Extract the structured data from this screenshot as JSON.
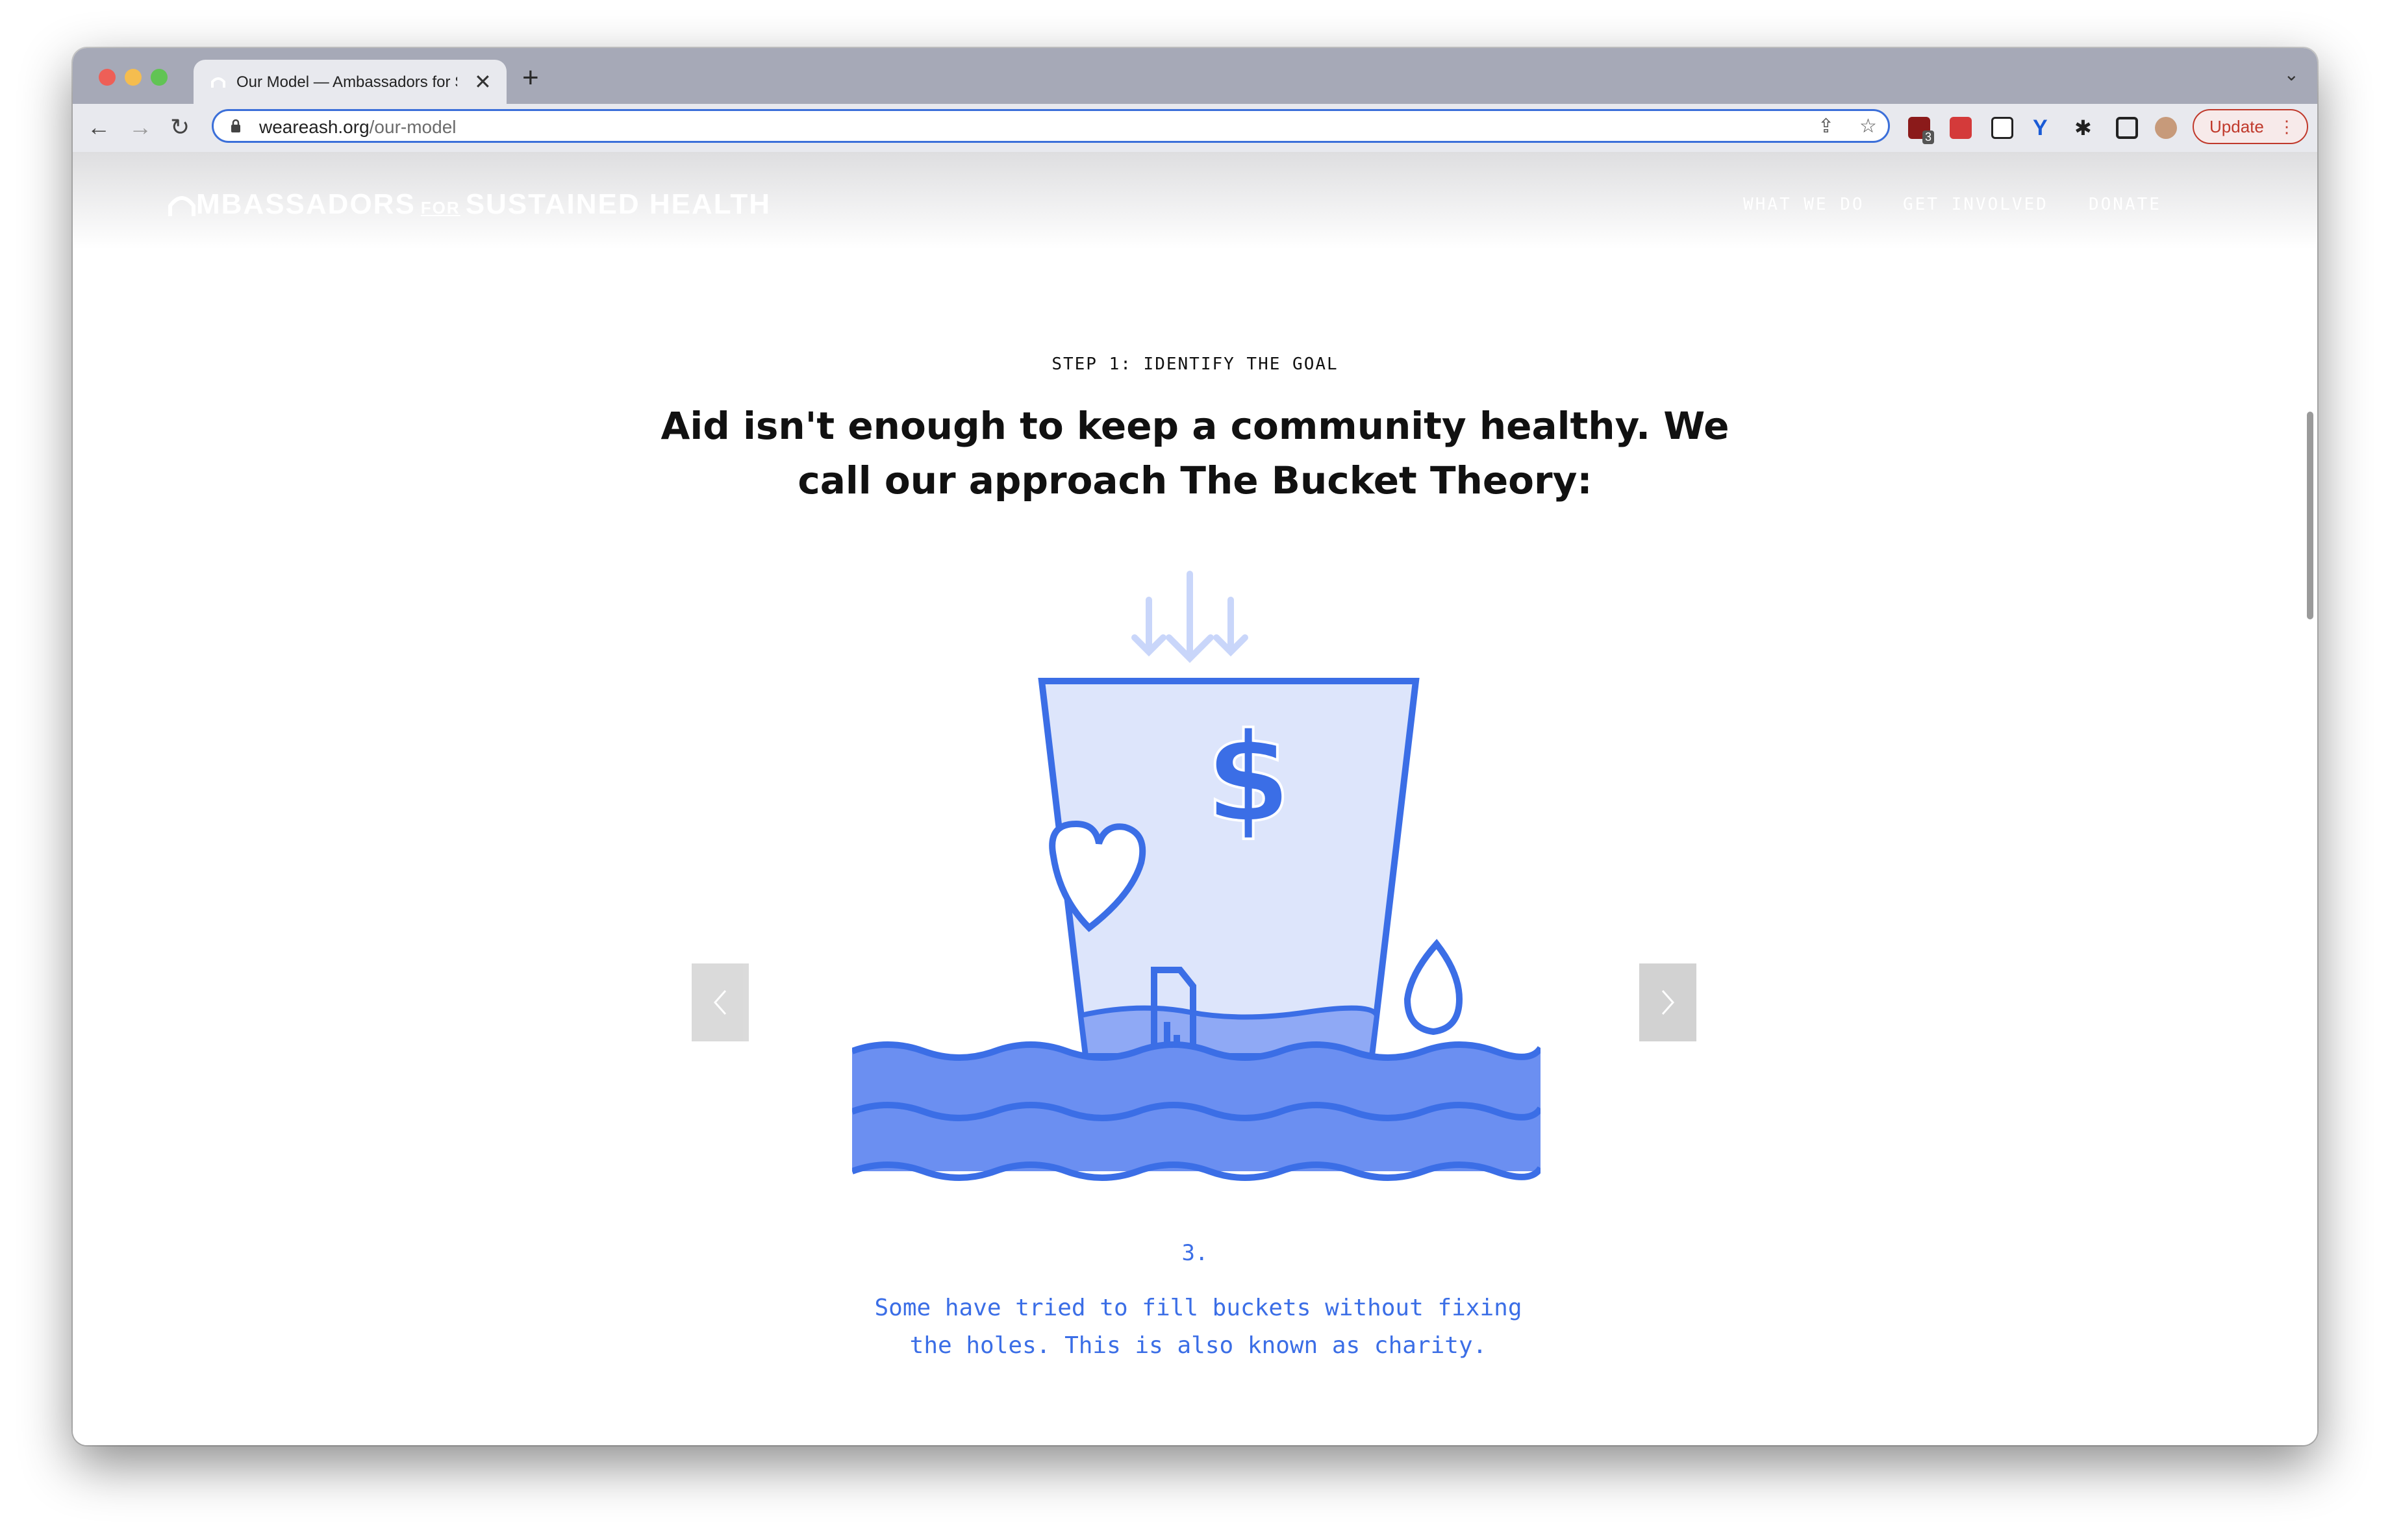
{
  "browser": {
    "tab_title": "Our Model — Ambassadors for Sustained Health",
    "url_host": "weareash.org",
    "url_path": "/our-model",
    "update_label": "Update",
    "extension_badge": "3"
  },
  "site": {
    "logo": {
      "part1": "MBASSADORS",
      "for": "FOR",
      "part2": "SUSTAINED HEALTH"
    },
    "nav": [
      {
        "label": "WHAT WE DO"
      },
      {
        "label": "GET INVOLVED"
      },
      {
        "label": "DONATE"
      }
    ]
  },
  "content": {
    "step_label": "STEP 1: IDENTIFY THE GOAL",
    "headline_line1": "Aid isn't enough to keep a community healthy. We",
    "headline_line2": "call our approach The Bucket Theory:",
    "slide_number": "3.",
    "caption_line1": "Some have tried to fill buckets without fixing",
    "caption_line2": "the holes. This is also known as charity.",
    "dollar_symbol": "$"
  },
  "colors": {
    "accent_blue": "#3b6ee6",
    "bucket_fill": "#dde5fb",
    "water_fill": "#6b8ff1",
    "arrow_light": "#c9d6fa"
  }
}
